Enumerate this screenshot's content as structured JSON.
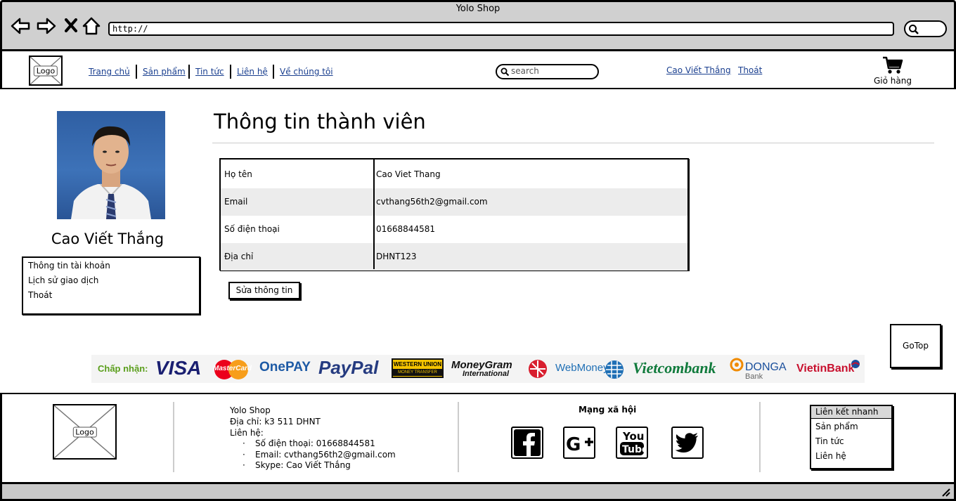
{
  "browser": {
    "title": "Yolo Shop",
    "url": "http://",
    "nav_icons": [
      "back-arrow-icon",
      "forward-arrow-icon",
      "close-icon",
      "home-icon"
    ]
  },
  "header": {
    "logo_label": "Logo",
    "nav": [
      "Trang chủ",
      "Sản phẩm",
      "Tin tức",
      "Liên hệ",
      "Về chúng tôi"
    ],
    "search_placeholder": "search",
    "user_name": "Cao Viết Thắng",
    "logout": "Thoát",
    "cart_label": "Giỏ hàng"
  },
  "sidebar": {
    "profile_name": "Cao Viết Thắng",
    "menu": [
      "Thông tin tài khoản",
      "Lịch sử giao dịch",
      "Thoát"
    ]
  },
  "main": {
    "title": "Thông tin thành viên",
    "rows": [
      {
        "label": "Họ tên",
        "value": "Cao Viet Thang"
      },
      {
        "label": "Email",
        "value": "cvthang56th2@gmail.com"
      },
      {
        "label": "Số điện thoại",
        "value": "01668844581"
      },
      {
        "label": "Địa chỉ",
        "value": "DHNT123"
      }
    ],
    "edit_button": "Sửa thông tin",
    "gotop": "GoTop"
  },
  "payment": {
    "label": "Chấp nhận:",
    "brands": [
      "VISA",
      "MasterCard",
      "OnePAY",
      "PayPal",
      "WESTERN UNION",
      "MONEY TRANSFER",
      "MoneyGram",
      "International",
      "WebMoney",
      "Vietcombank",
      "DONGA",
      "Bank",
      "VietinBank"
    ]
  },
  "footer": {
    "logo_label": "Logo",
    "shop_name": "Yolo Shop",
    "address": "Địa chỉ: k3 511 DHNT",
    "contact_label": "Liên hệ:",
    "contacts": [
      "Số điện thoại: 01668844581",
      "Email: cvthang56th2@gmail.com",
      "Skype: Cao Viết Thắng"
    ],
    "social_title": "Mạng xã hội",
    "social": [
      "facebook-icon",
      "google-plus-icon",
      "youtube-icon",
      "twitter-icon"
    ],
    "quick_links_title": "Liên kết nhanh",
    "quick_links": [
      "Sản phẩm",
      "Tin tức",
      "Liên hệ"
    ]
  },
  "colors": {
    "link": "#1a3f8f",
    "chrome": "#d0d0d0",
    "row_alt": "#ececec",
    "visa": "#1a1f71",
    "paypal": "#253b80",
    "vietcombank": "#0f7a3b",
    "accept_label": "#5a9e1b"
  }
}
